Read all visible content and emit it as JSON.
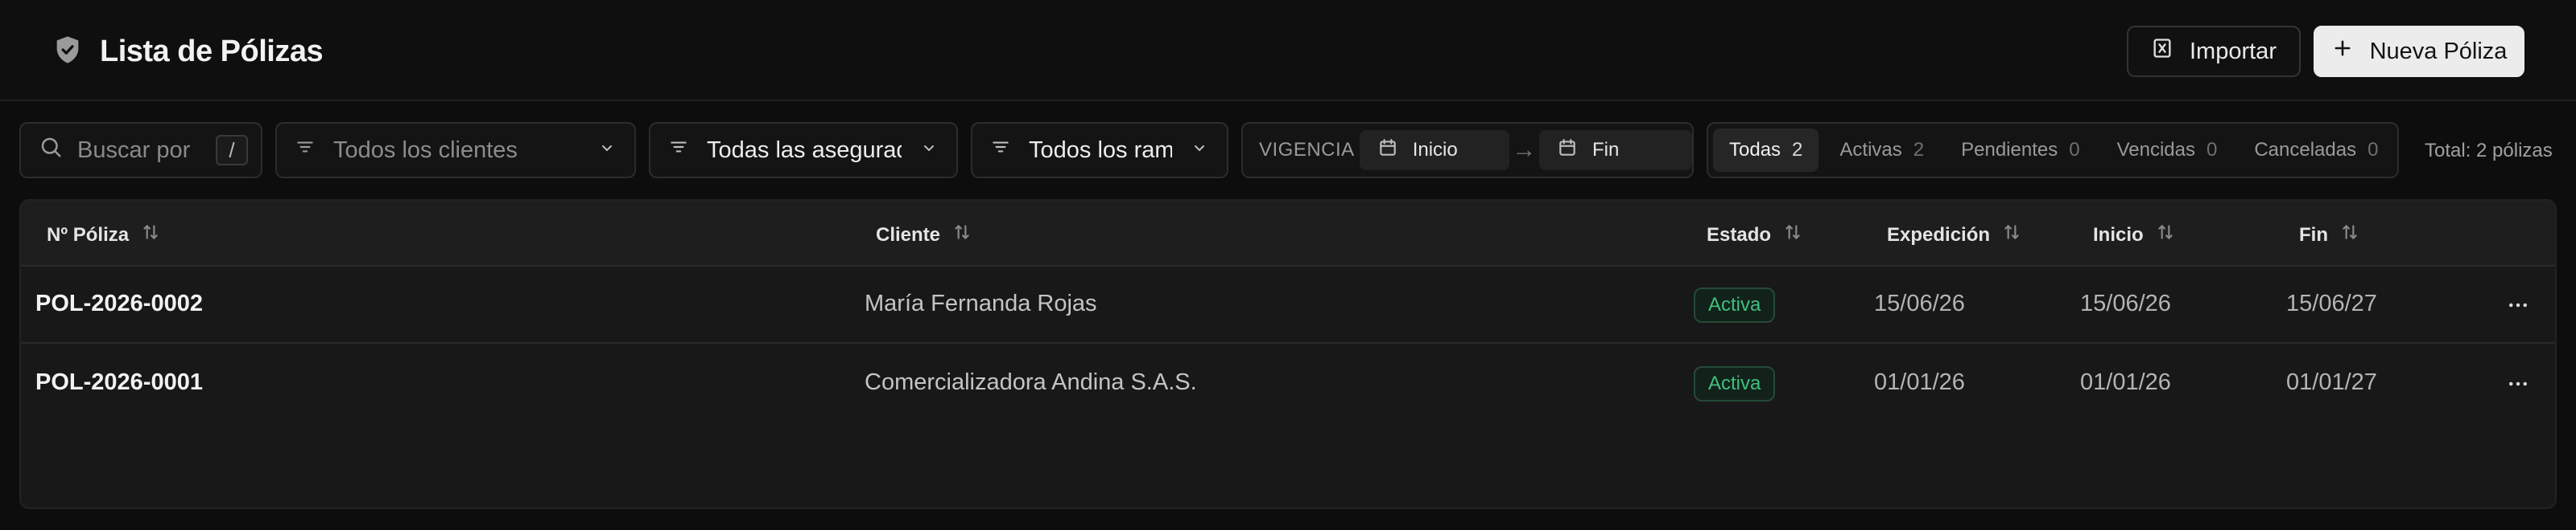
{
  "header": {
    "title": "Lista de Pólizas",
    "import_label": "Importar",
    "new_label": "Nueva Póliza"
  },
  "filters": {
    "search_placeholder": "Buscar por",
    "search_shortcut": "/",
    "clients_value": "Todos los clientes",
    "insurers_value": "Todas las aseguradoras",
    "ramos_value": "Todos los ramos",
    "vigencia_label": "VIGENCIA",
    "start_placeholder": "Inicio",
    "end_placeholder": "Fin",
    "status_tabs": [
      {
        "label": "Todas",
        "count": "2"
      },
      {
        "label": "Activas",
        "count": "2"
      },
      {
        "label": "Pendientes",
        "count": "0"
      },
      {
        "label": "Vencidas",
        "count": "0"
      },
      {
        "label": "Canceladas",
        "count": "0"
      }
    ],
    "selected_status": "Todas",
    "total_text": "Total: 2 pólizas"
  },
  "table": {
    "columns": [
      "Nº Póliza",
      "Cliente",
      "Estado",
      "Expedición",
      "Inicio",
      "Fin"
    ],
    "rows": [
      {
        "numero": "POL-2026-0002",
        "cliente": "María Fernanda Rojas",
        "estado": "Activa",
        "expedicion": "15/06/26",
        "inicio": "15/06/26",
        "fin": "15/06/27"
      },
      {
        "numero": "POL-2026-0001",
        "cliente": "Comercializadora Andina S.A.S.",
        "estado": "Activa",
        "expedicion": "01/01/26",
        "inicio": "01/01/26",
        "fin": "01/01/27"
      }
    ]
  },
  "colors": {
    "background": "#0d0d0d",
    "surface": "#181818",
    "active_badge_text": "#3fc07e",
    "primary_button": "#ececec"
  }
}
